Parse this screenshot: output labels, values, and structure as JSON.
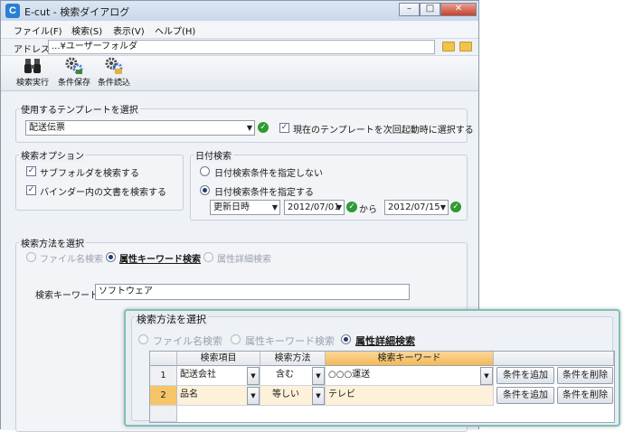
{
  "window": {
    "title": "E-cut - 検索ダイアログ",
    "app_icon_glyph": "C",
    "controls": {
      "minimize": "–",
      "maximize": "□",
      "close": "✕"
    }
  },
  "menu": [
    "ファイル(F)",
    "検索(S)",
    "表示(V)",
    "ヘルプ(H)"
  ],
  "address": {
    "label": "アドレス",
    "value": "...¥ユーザーフォルダ"
  },
  "toolbar": [
    {
      "label": "検索実行",
      "icon": "binoculars-icon"
    },
    {
      "label": "条件保存",
      "icon": "gears-save-icon"
    },
    {
      "label": "条件読込",
      "icon": "gears-lock-icon"
    }
  ],
  "template_group": {
    "title": "使用するテンプレートを選択",
    "selected": "配送伝票",
    "checkbox_label": "現在のテンプレートを次回起動時に選択する",
    "checkbox_checked": true
  },
  "search_options": {
    "title": "検索オプション",
    "items": [
      {
        "label": "サブフォルダを検索する",
        "checked": true
      },
      {
        "label": "バインダー内の文書を検索する",
        "checked": true
      }
    ]
  },
  "date_search": {
    "title": "日付検索",
    "option_none": "日付検索条件を指定しない",
    "option_set": "日付検索条件を指定する",
    "field": "更新日時",
    "from_date": "2012/07/01",
    "from_suffix": "から",
    "to_date": "2012/07/15"
  },
  "method_group": {
    "title": "検索方法を選択",
    "options": [
      "ファイル名検索",
      "属性キーワード検索",
      "属性詳細検索"
    ],
    "selected_index": 1,
    "keyword_label": "検索キーワード",
    "keyword_value": "ソフトウェア"
  },
  "overlay": {
    "title": "検索方法を選択",
    "options": [
      "ファイル名検索",
      "属性キーワード検索",
      "属性詳細検索"
    ],
    "selected_index": 2,
    "columns": [
      "検索項目",
      "検索方法",
      "検索キーワード"
    ],
    "rows": [
      {
        "num": "1",
        "item": "配送会社",
        "method": "含む",
        "keyword": "○○○運送"
      },
      {
        "num": "2",
        "item": "品名",
        "method": "等しい",
        "keyword": "テレビ"
      }
    ],
    "add_button": "条件を追加",
    "delete_button": "条件を削除"
  }
}
